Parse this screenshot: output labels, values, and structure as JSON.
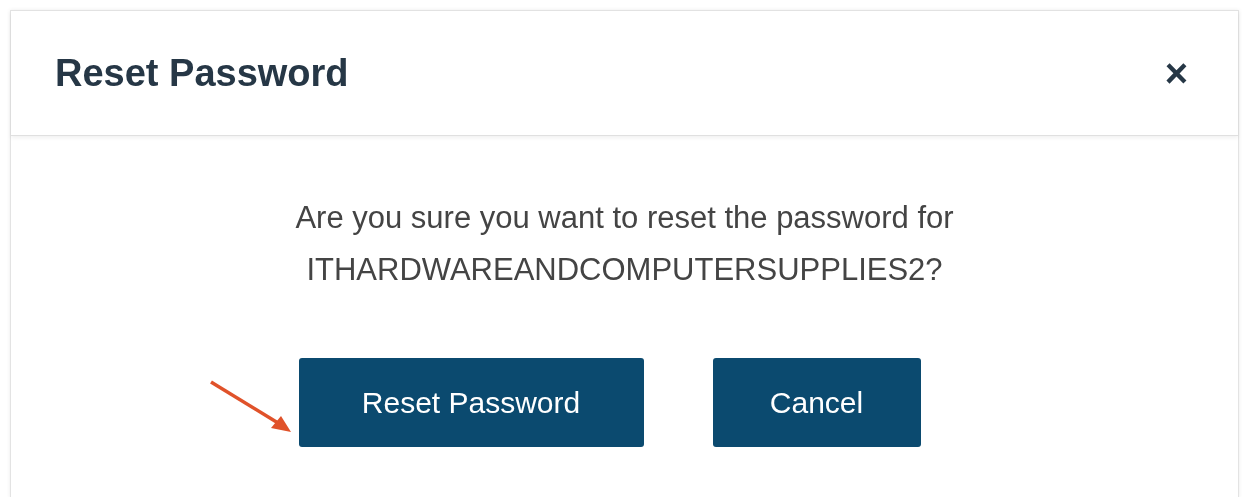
{
  "dialog": {
    "title": "Reset Password",
    "close": "×",
    "message": [
      "Are you sure you want to reset the password for",
      "ITHARDWAREANDCOMPUTERSUPPLIES2?"
    ],
    "buttons": [
      {
        "label": "Reset Password",
        "kind": "primary"
      },
      {
        "label": "Cancel",
        "kind": "secondary"
      }
    ]
  }
}
